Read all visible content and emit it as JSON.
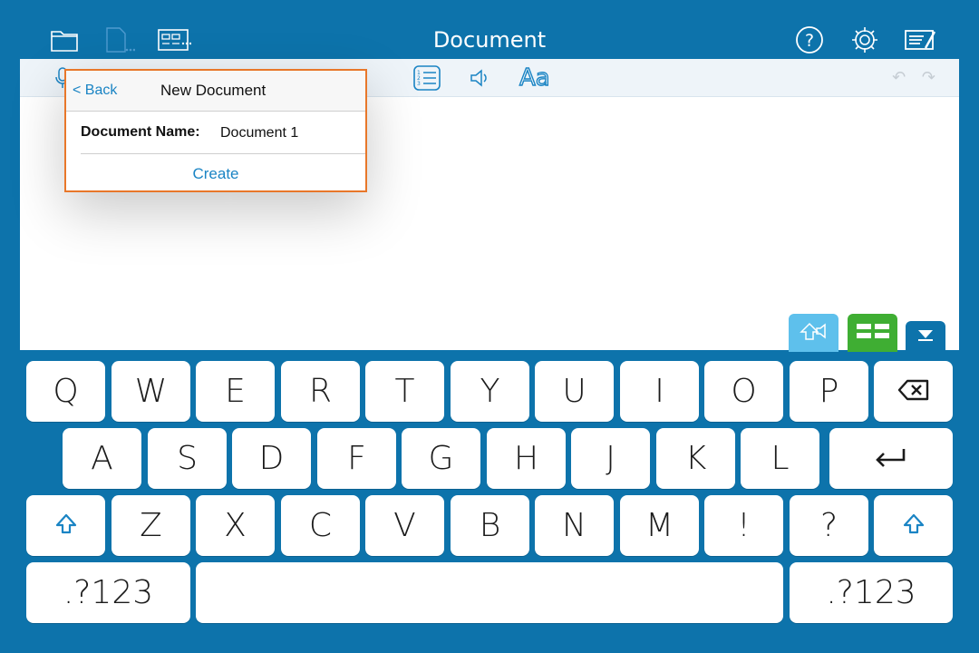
{
  "app": {
    "title": "Document",
    "colors": {
      "background": "#0d73ab",
      "accent": "#1a84c4",
      "popover_border": "#e8772a",
      "predict_green": "#3fae33",
      "speak_light_blue": "#5ec0ec"
    }
  },
  "topbar": {
    "left_icons": [
      "folder-icon",
      "new-document-icon",
      "word-bank-icon"
    ],
    "right_icons": [
      "help-icon",
      "settings-icon",
      "edit-mode-icon"
    ]
  },
  "toolbar": {
    "icons": [
      "microphone-icon",
      "numbered-list-icon",
      "speaker-icon",
      "font-icon",
      "undo-icon",
      "redo-icon"
    ],
    "font_label": "Aa",
    "undo_redo": "↶ ↷"
  },
  "popover": {
    "back_label": "< Back",
    "title": "New Document",
    "name_label": "Document Name:",
    "name_value": "Document 1",
    "create_label": "Create"
  },
  "floating_buttons": [
    "speak-selection-icon",
    "word-prediction-icon",
    "hide-keyboard-icon"
  ],
  "keyboard": {
    "row1": [
      "Q",
      "W",
      "E",
      "R",
      "T",
      "Y",
      "U",
      "I",
      "O",
      "P"
    ],
    "row2": [
      "A",
      "S",
      "D",
      "F",
      "G",
      "H",
      "J",
      "K",
      "L"
    ],
    "row3": [
      "Z",
      "X",
      "C",
      "V",
      "B",
      "N",
      "M",
      "!",
      "?"
    ],
    "numbers_left": ".?123",
    "numbers_right": ".?123",
    "icons": [
      "backspace-icon",
      "return-icon",
      "shift-icon"
    ]
  }
}
